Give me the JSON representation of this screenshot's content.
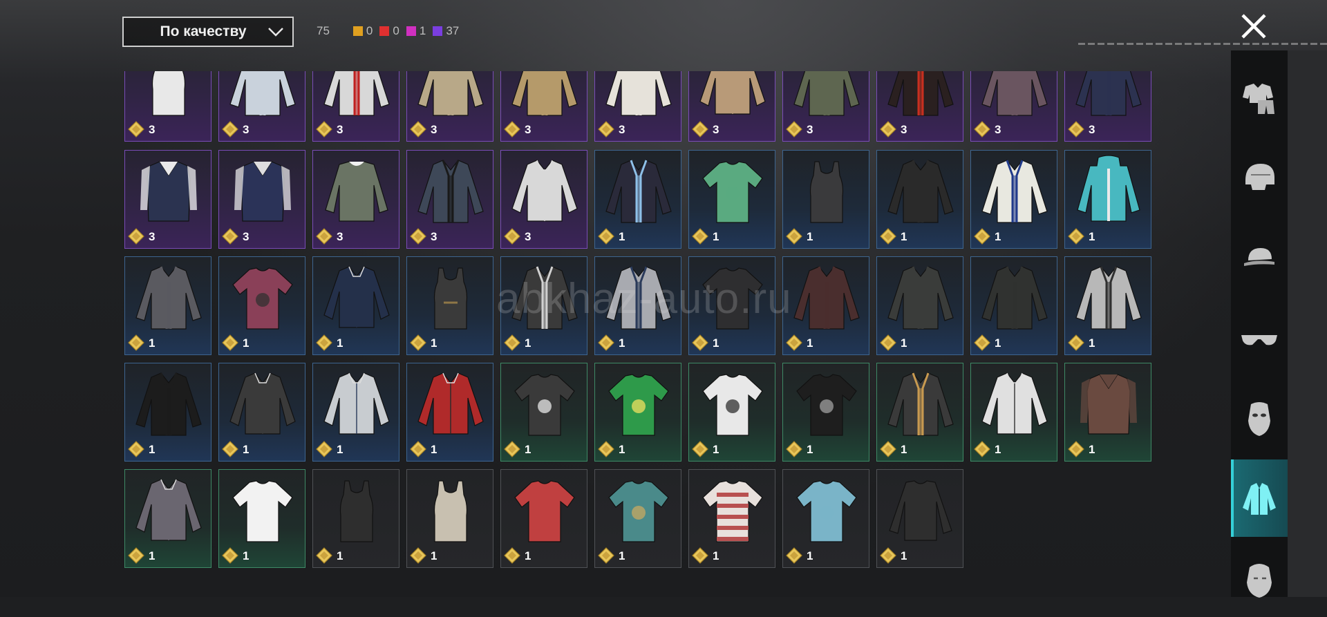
{
  "header": {
    "sort_label": "По качеству",
    "total_count": "75",
    "quality_counts": [
      {
        "color": "#e0a020",
        "count": "0"
      },
      {
        "color": "#e03030",
        "count": "0"
      },
      {
        "color": "#d030c0",
        "count": "1"
      },
      {
        "color": "#7a3ee0",
        "count": "37"
      }
    ]
  },
  "close_icon": "close-icon",
  "watermark": "abkhaz-auto.ru",
  "rows": [
    [
      {
        "rarity": "purple",
        "kind": "tank",
        "color": "#e8e8e8",
        "count": "3"
      },
      {
        "rarity": "purple",
        "kind": "jacket",
        "color": "#c9d2dc",
        "count": "3"
      },
      {
        "rarity": "purple",
        "kind": "jacket",
        "color": "#d8d8d8",
        "accent": "#c02020",
        "count": "3"
      },
      {
        "rarity": "purple",
        "kind": "jacket",
        "color": "#b8a888",
        "count": "3"
      },
      {
        "rarity": "purple",
        "kind": "jacket",
        "color": "#b59a6a",
        "count": "3"
      },
      {
        "rarity": "purple",
        "kind": "jacket",
        "color": "#e6e2da",
        "count": "3"
      },
      {
        "rarity": "purple",
        "kind": "shirt",
        "color": "#b89a78",
        "count": "3"
      },
      {
        "rarity": "purple",
        "kind": "jacket",
        "color": "#5e6650",
        "count": "3"
      },
      {
        "rarity": "purple",
        "kind": "jacket",
        "color": "#2a2020",
        "accent": "#c83020",
        "count": "3"
      },
      {
        "rarity": "purple",
        "kind": "jacket",
        "color": "#6a5560",
        "count": "3"
      },
      {
        "rarity": "purple",
        "kind": "jacket",
        "color": "#2c3250",
        "count": "3"
      }
    ],
    [
      {
        "rarity": "purple",
        "kind": "vest",
        "color": "#2b3350",
        "accent": "#ffffff",
        "count": "3"
      },
      {
        "rarity": "purple",
        "kind": "vest",
        "color": "#2b3358",
        "accent": "#f2f2f2",
        "count": "3"
      },
      {
        "rarity": "purple",
        "kind": "sweater",
        "color": "#6a7464",
        "count": "3"
      },
      {
        "rarity": "purple",
        "kind": "jacket",
        "color": "#3e4858",
        "accent": "#1a1a1a",
        "count": "3"
      },
      {
        "rarity": "purple",
        "kind": "shirt",
        "color": "#d8d8d8",
        "count": "3"
      },
      {
        "rarity": "blue",
        "kind": "jacket",
        "color": "#2a2a3a",
        "accent": "#8ec0e8",
        "count": "1"
      },
      {
        "rarity": "blue",
        "kind": "tshirt",
        "color": "#5aaa80",
        "count": "1"
      },
      {
        "rarity": "blue",
        "kind": "tank",
        "color": "#3a3a3c",
        "count": "1"
      },
      {
        "rarity": "blue",
        "kind": "jacket",
        "color": "#2a2a2a",
        "count": "1"
      },
      {
        "rarity": "blue",
        "kind": "jacket",
        "color": "#e8e8e0",
        "accent": "#203a8a",
        "count": "1"
      },
      {
        "rarity": "blue",
        "kind": "hoodie",
        "color": "#48b8c0",
        "count": "1"
      }
    ],
    [
      {
        "rarity": "blue",
        "kind": "jacket",
        "color": "#5a5a60",
        "count": "1"
      },
      {
        "rarity": "blue",
        "kind": "tshirt",
        "color": "#8a4058",
        "accent": "#303030",
        "count": "1"
      },
      {
        "rarity": "blue",
        "kind": "shirt",
        "color": "#24304a",
        "count": "1"
      },
      {
        "rarity": "blue",
        "kind": "tank",
        "color": "#3a3a3a",
        "accent": "#c8a050",
        "count": "1"
      },
      {
        "rarity": "blue",
        "kind": "jacket",
        "color": "#3a3a3a",
        "accent": "#d0d0d0",
        "count": "1"
      },
      {
        "rarity": "blue",
        "kind": "jacket",
        "color": "#a8aab0",
        "accent": "#2a3a5a",
        "count": "1"
      },
      {
        "rarity": "blue",
        "kind": "tshirt",
        "color": "#2e2e30",
        "count": "1"
      },
      {
        "rarity": "blue",
        "kind": "jacket",
        "color": "#4a2e2e",
        "count": "1"
      },
      {
        "rarity": "blue",
        "kind": "jacket",
        "color": "#3a3c3a",
        "count": "1"
      },
      {
        "rarity": "blue",
        "kind": "jacket",
        "color": "#303230",
        "count": "1"
      },
      {
        "rarity": "blue",
        "kind": "jacket",
        "color": "#b8b8b8",
        "accent": "#303030",
        "count": "1"
      }
    ],
    [
      {
        "rarity": "blue",
        "kind": "jacket",
        "color": "#1c1c1c",
        "count": "1"
      },
      {
        "rarity": "blue",
        "kind": "shirt",
        "color": "#3a3a3a",
        "count": "1"
      },
      {
        "rarity": "blue",
        "kind": "shirt",
        "color": "#c8ccd0",
        "accent": "#2a3a5a",
        "count": "1"
      },
      {
        "rarity": "blue",
        "kind": "shirt",
        "color": "#b02a2a",
        "accent": "#2a2a2a",
        "count": "1"
      },
      {
        "rarity": "green",
        "kind": "tshirt",
        "color": "#3a3a3a",
        "accent": "#e8e8e8",
        "count": "1"
      },
      {
        "rarity": "green",
        "kind": "tshirt",
        "color": "#2e9a4a",
        "accent": "#f0e060",
        "count": "1"
      },
      {
        "rarity": "green",
        "kind": "tshirt",
        "color": "#e8e8e8",
        "accent": "#303030",
        "count": "1"
      },
      {
        "rarity": "green",
        "kind": "tshirt",
        "color": "#1e1e1e",
        "accent": "#a0a0a0",
        "count": "1"
      },
      {
        "rarity": "green",
        "kind": "jacket",
        "color": "#3a3a3a",
        "accent": "#c89a50",
        "count": "1"
      },
      {
        "rarity": "green",
        "kind": "shirt",
        "color": "#e0e0e0",
        "accent": "#303030",
        "count": "1"
      },
      {
        "rarity": "green",
        "kind": "vest",
        "color": "#6a4a40",
        "accent": "#6a4a40",
        "count": "1"
      }
    ],
    [
      {
        "rarity": "green",
        "kind": "shirt",
        "color": "#6a6670",
        "count": "1"
      },
      {
        "rarity": "green",
        "kind": "tshirt",
        "color": "#f2f2f2",
        "count": "1"
      },
      {
        "rarity": "gray",
        "kind": "tank",
        "color": "#2e2e2e",
        "count": "1"
      },
      {
        "rarity": "gray",
        "kind": "tank",
        "color": "#c8c0b0",
        "count": "1"
      },
      {
        "rarity": "gray",
        "kind": "tshirt",
        "color": "#c04040",
        "count": "1"
      },
      {
        "rarity": "gray",
        "kind": "tshirt",
        "color": "#4a8a8a",
        "accent": "#c8a860",
        "count": "1"
      },
      {
        "rarity": "gray",
        "kind": "striped",
        "color": "#e8e0dc",
        "accent": "#b85050",
        "count": "1"
      },
      {
        "rarity": "gray",
        "kind": "tshirt",
        "color": "#7ab4c8",
        "count": "1"
      },
      {
        "rarity": "gray",
        "kind": "longsleeve",
        "color": "#2e2e2e",
        "count": "1"
      }
    ]
  ],
  "side_nav": [
    {
      "icon": "outfit-icon",
      "active": false
    },
    {
      "icon": "helmet-icon",
      "active": false
    },
    {
      "icon": "cap-icon",
      "active": false
    },
    {
      "icon": "glasses-icon",
      "active": false
    },
    {
      "icon": "mask-icon",
      "active": false
    },
    {
      "icon": "shirt-icon",
      "active": true
    },
    {
      "icon": "face-icon",
      "active": false
    }
  ]
}
